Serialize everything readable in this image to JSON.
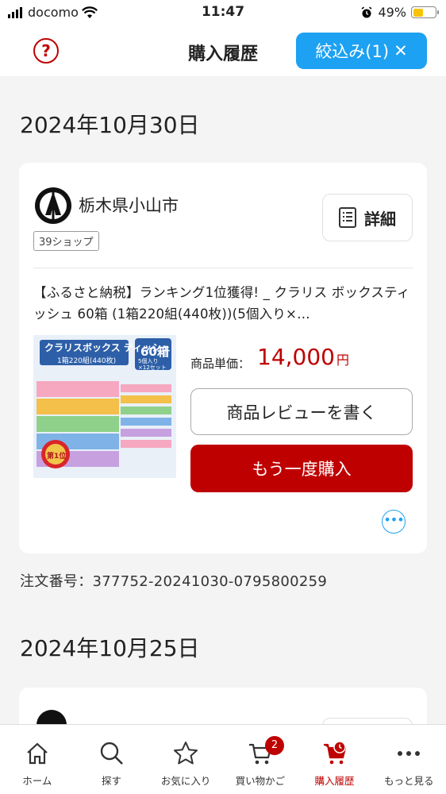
{
  "status_bar": {
    "carrier": "docomo",
    "time": "11:47",
    "battery": "49%"
  },
  "header": {
    "title": "購入履歴",
    "help_icon_text": "?",
    "filter_label": "絞込み(1)",
    "filter_clear": "✕"
  },
  "orders": [
    {
      "date": "2024年10月30日",
      "shop_name": "栃木県小山市",
      "shop_badge": "39ショップ",
      "detail_label": "詳細",
      "product_title": "【ふるさと納税】ランキング1位獲得! _ クラリス ボックスティッシュ 60箱 (1箱220組(440枚))(5個入り×…",
      "image_texts": {
        "brand": "クラリスボックス ティッシュ",
        "sub": "1箱220組(440枚)",
        "count": "60箱",
        "count_sub": "5個入り×12セット",
        "rank": "第1位"
      },
      "price_label": "商品単価：",
      "price": "14,000",
      "price_unit": "円",
      "review_label": "商品レビューを書く",
      "rebuy_label": "もう一度購入",
      "more_icon": "•••",
      "order_number": "注文番号：377752-20241030-0795800259"
    },
    {
      "date": "2024年10月25日"
    }
  ],
  "tabbar": {
    "items": [
      {
        "label": "ホーム",
        "icon": "home-icon"
      },
      {
        "label": "探す",
        "icon": "search-icon"
      },
      {
        "label": "お気に入り",
        "icon": "star-icon"
      },
      {
        "label": "買い物かご",
        "icon": "cart-icon",
        "badge": "2"
      },
      {
        "label": "購入履歴",
        "icon": "history-icon",
        "active": true
      },
      {
        "label": "もっと見る",
        "icon": "more-icon"
      }
    ]
  },
  "colors": {
    "accent_red": "#bf0000",
    "accent_blue": "#1da1f2",
    "background": "#f4f4f4"
  }
}
